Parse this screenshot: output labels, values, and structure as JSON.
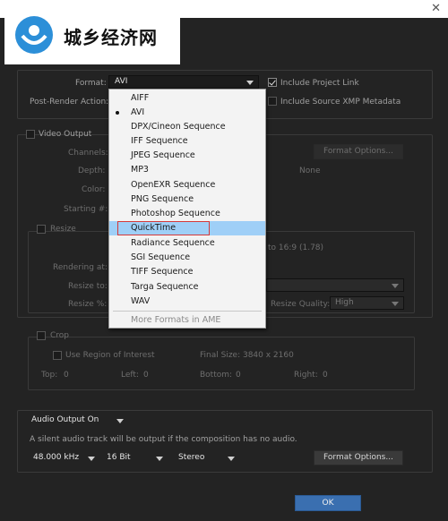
{
  "window": {
    "close_glyph": "✕"
  },
  "watermark": {
    "text": "城乡经济网",
    "icon": "globe-logo-icon"
  },
  "format": {
    "label": "Format:",
    "value": "AVI",
    "include_project_link": "Include Project Link",
    "post_render_label": "Post-Render Action:",
    "include_xmp": "Include Source XMP Metadata"
  },
  "video_output": {
    "label": "Video Output",
    "channels": "Channels:",
    "format_options": "Format Options...",
    "depth": "Depth:",
    "depth_value": "None",
    "color": "Color:",
    "starting": "Starting #:"
  },
  "resize": {
    "label": "Resize",
    "aspect": "to 16:9 (1.78)",
    "rendering_at": "Rendering at:",
    "resize_to": "Resize to:",
    "resize_pct": "Resize %:",
    "quality_label": "Resize Quality:",
    "quality_value": "High"
  },
  "crop": {
    "label": "Crop",
    "use_roi": "Use Region of Interest",
    "final_size": "Final Size: 3840 x 2160",
    "top": "Top:",
    "top_v": "0",
    "left": "Left:",
    "left_v": "0",
    "bottom": "Bottom:",
    "bottom_v": "0",
    "right": "Right:",
    "right_v": "0"
  },
  "audio": {
    "output": "Audio Output On",
    "note": "A silent audio track will be output if the composition has no audio.",
    "rate": "48.000 kHz",
    "bits": "16 Bit",
    "channels": "Stereo",
    "format_options": "Format Options..."
  },
  "dropdown_items": [
    "AIFF",
    "AVI",
    "DPX/Cineon Sequence",
    "IFF Sequence",
    "JPEG Sequence",
    "MP3",
    "OpenEXR Sequence",
    "PNG Sequence",
    "Photoshop Sequence",
    "QuickTime",
    "Radiance Sequence",
    "SGI Sequence",
    "TIFF Sequence",
    "Targa Sequence",
    "WAV"
  ],
  "dropdown_more": "More Formats in AME",
  "ok": "OK"
}
